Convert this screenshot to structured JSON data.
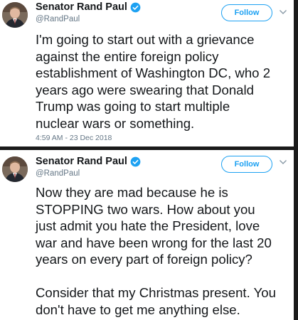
{
  "tweets": [
    {
      "display_name": "Senator Rand Paul",
      "handle": "@RandPaul",
      "follow_label": "Follow",
      "text": "I'm going to start out with a grievance\nagainst the entire foreign policy\nestablishment of Washington DC, who 2\nyears ago were swearing that Donald\nTrump was going to start multiple\nnuclear wars or something.",
      "timestamp": "4:59 AM - 23 Dec 2018"
    },
    {
      "display_name": "Senator Rand Paul",
      "handle": "@RandPaul",
      "follow_label": "Follow",
      "text": "Now they are mad because he is\nSTOPPING two wars.  How about you\njust admit you hate the President, love\nwar and have been wrong for the last 20\nyears on every part of foreign policy?\n\nConsider that my Christmas present. You\ndon't have to get me anything else."
    }
  ],
  "icons": {
    "verified": "verified-badge-icon",
    "menu": "chevron-down-icon",
    "avatar": "profile-photo"
  },
  "colors": {
    "accent": "#1da1f2",
    "secondary_text": "#657786",
    "primary_text": "#14171a",
    "separator": "#1a1a1a"
  }
}
